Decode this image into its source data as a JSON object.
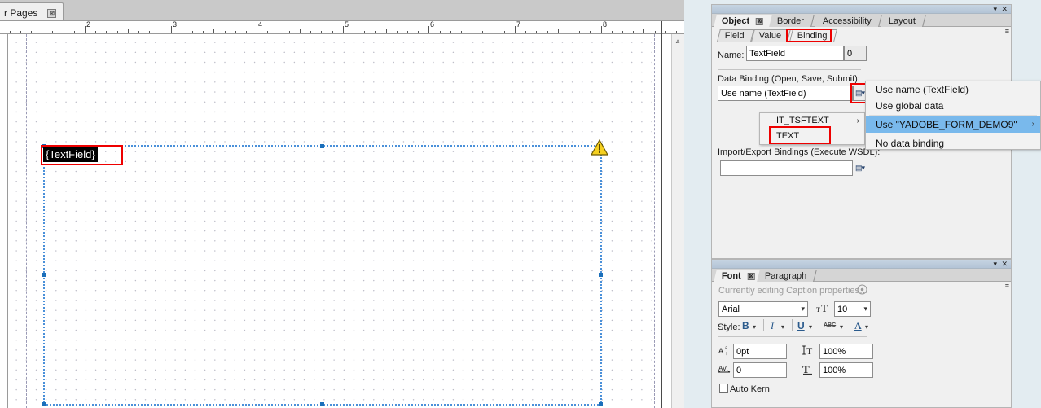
{
  "canvas": {
    "document_tab": {
      "label": "r Pages",
      "close_glyph": "⊠"
    },
    "ruler": {
      "unit_labels": [
        "2",
        "3",
        "4",
        "5",
        "6",
        "7",
        "8"
      ],
      "first_label_x": 104,
      "spacing_px": 105.6
    },
    "text_field": {
      "caption": "{TextField}",
      "warning_icon": "warning-triangle-icon",
      "warning_glyph": "!"
    }
  },
  "object_panel": {
    "tabs": [
      {
        "label": "Object",
        "active": true,
        "closable": true
      },
      {
        "label": "Border",
        "active": false,
        "closable": false
      },
      {
        "label": "Accessibility",
        "active": false,
        "closable": false
      },
      {
        "label": "Layout",
        "active": false,
        "closable": false
      }
    ],
    "subtabs": [
      {
        "label": "Field",
        "active": false
      },
      {
        "label": "Value",
        "active": false
      },
      {
        "label": "Binding",
        "active": true,
        "highlighted": true
      }
    ],
    "name_label": "Name:",
    "name_value": "TextField",
    "name_index_value": "0",
    "data_binding_label": "Data Binding (Open, Save, Submit):",
    "data_binding_value": "Use name (TextField)",
    "data_binding_button": "list-picker-icon",
    "import_export_label": "Import/Export Bindings (Execute WSDL):",
    "import_export_value": "",
    "import_export_button": "list-picker-icon",
    "minimize_glyph": "▾",
    "close_glyph": "✕",
    "panel_menu_glyph": "≡"
  },
  "binding_menu": {
    "items": [
      {
        "label": "Use name (TextField)",
        "selected": false,
        "has_submenu": false
      },
      {
        "label": "Use global data",
        "selected": false,
        "has_submenu": false
      },
      {
        "label": "Use \"YADOBE_FORM_DEMO9\"",
        "selected": true,
        "has_submenu": true
      },
      {
        "label": "No data binding",
        "selected": false,
        "has_submenu": false
      }
    ],
    "submenu_arrow": "›",
    "highlight_color": "#79b9ec"
  },
  "data_submenu": {
    "items": [
      {
        "label": "IT_TSFTEXT",
        "has_submenu": true,
        "highlighted": false
      },
      {
        "label": "TEXT",
        "has_submenu": false,
        "highlighted": true
      }
    ],
    "submenu_arrow": "›",
    "highlight_border_color": "#ee0000"
  },
  "font_panel": {
    "tabs": [
      {
        "label": "Font",
        "active": true,
        "closable": true
      },
      {
        "label": "Paragraph",
        "active": false,
        "closable": false
      }
    ],
    "status_text": "Currently editing Caption properties…",
    "status_icon": "target-circle-icon",
    "font_family": "Arial",
    "font_size_icon": "font-size-icon",
    "font_size": "10",
    "style_label": "Style:",
    "style_buttons": [
      {
        "name": "bold-button",
        "glyph": "B"
      },
      {
        "name": "italic-button",
        "glyph": "I"
      },
      {
        "name": "underline-button",
        "glyph": "U"
      },
      {
        "name": "strikethrough-button",
        "glyph": "ABC"
      },
      {
        "name": "font-color-button",
        "glyph": "A"
      }
    ],
    "baseline_shift_icon": "baseline-shift-icon",
    "baseline_shift_value": "0pt",
    "tracking_icon": "tracking-icon",
    "tracking_value": "0",
    "vertical_scale_icon": "vertical-scale-icon",
    "vertical_scale_value": "100%",
    "horizontal_scale_icon": "horizontal-scale-icon",
    "horizontal_scale_value": "100%",
    "auto_kern_label": "Auto Kern",
    "auto_kern_checked": false,
    "minimize_glyph": "▾",
    "close_glyph": "✕",
    "panel_menu_glyph": "≡"
  }
}
